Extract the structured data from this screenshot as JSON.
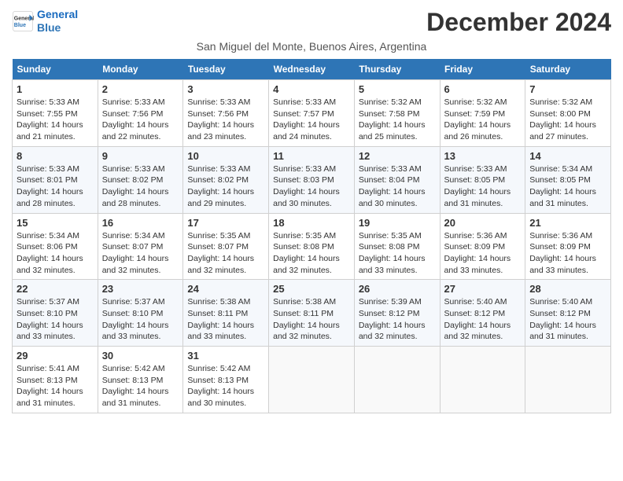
{
  "logo": {
    "line1": "General",
    "line2": "Blue"
  },
  "title": "December 2024",
  "subtitle": "San Miguel del Monte, Buenos Aires, Argentina",
  "weekdays": [
    "Sunday",
    "Monday",
    "Tuesday",
    "Wednesday",
    "Thursday",
    "Friday",
    "Saturday"
  ],
  "weeks": [
    [
      {
        "day": "1",
        "info": "Sunrise: 5:33 AM\nSunset: 7:55 PM\nDaylight: 14 hours\nand 21 minutes."
      },
      {
        "day": "2",
        "info": "Sunrise: 5:33 AM\nSunset: 7:56 PM\nDaylight: 14 hours\nand 22 minutes."
      },
      {
        "day": "3",
        "info": "Sunrise: 5:33 AM\nSunset: 7:56 PM\nDaylight: 14 hours\nand 23 minutes."
      },
      {
        "day": "4",
        "info": "Sunrise: 5:33 AM\nSunset: 7:57 PM\nDaylight: 14 hours\nand 24 minutes."
      },
      {
        "day": "5",
        "info": "Sunrise: 5:32 AM\nSunset: 7:58 PM\nDaylight: 14 hours\nand 25 minutes."
      },
      {
        "day": "6",
        "info": "Sunrise: 5:32 AM\nSunset: 7:59 PM\nDaylight: 14 hours\nand 26 minutes."
      },
      {
        "day": "7",
        "info": "Sunrise: 5:32 AM\nSunset: 8:00 PM\nDaylight: 14 hours\nand 27 minutes."
      }
    ],
    [
      {
        "day": "8",
        "info": "Sunrise: 5:33 AM\nSunset: 8:01 PM\nDaylight: 14 hours\nand 28 minutes."
      },
      {
        "day": "9",
        "info": "Sunrise: 5:33 AM\nSunset: 8:02 PM\nDaylight: 14 hours\nand 28 minutes."
      },
      {
        "day": "10",
        "info": "Sunrise: 5:33 AM\nSunset: 8:02 PM\nDaylight: 14 hours\nand 29 minutes."
      },
      {
        "day": "11",
        "info": "Sunrise: 5:33 AM\nSunset: 8:03 PM\nDaylight: 14 hours\nand 30 minutes."
      },
      {
        "day": "12",
        "info": "Sunrise: 5:33 AM\nSunset: 8:04 PM\nDaylight: 14 hours\nand 30 minutes."
      },
      {
        "day": "13",
        "info": "Sunrise: 5:33 AM\nSunset: 8:05 PM\nDaylight: 14 hours\nand 31 minutes."
      },
      {
        "day": "14",
        "info": "Sunrise: 5:34 AM\nSunset: 8:05 PM\nDaylight: 14 hours\nand 31 minutes."
      }
    ],
    [
      {
        "day": "15",
        "info": "Sunrise: 5:34 AM\nSunset: 8:06 PM\nDaylight: 14 hours\nand 32 minutes."
      },
      {
        "day": "16",
        "info": "Sunrise: 5:34 AM\nSunset: 8:07 PM\nDaylight: 14 hours\nand 32 minutes."
      },
      {
        "day": "17",
        "info": "Sunrise: 5:35 AM\nSunset: 8:07 PM\nDaylight: 14 hours\nand 32 minutes."
      },
      {
        "day": "18",
        "info": "Sunrise: 5:35 AM\nSunset: 8:08 PM\nDaylight: 14 hours\nand 32 minutes."
      },
      {
        "day": "19",
        "info": "Sunrise: 5:35 AM\nSunset: 8:08 PM\nDaylight: 14 hours\nand 33 minutes."
      },
      {
        "day": "20",
        "info": "Sunrise: 5:36 AM\nSunset: 8:09 PM\nDaylight: 14 hours\nand 33 minutes."
      },
      {
        "day": "21",
        "info": "Sunrise: 5:36 AM\nSunset: 8:09 PM\nDaylight: 14 hours\nand 33 minutes."
      }
    ],
    [
      {
        "day": "22",
        "info": "Sunrise: 5:37 AM\nSunset: 8:10 PM\nDaylight: 14 hours\nand 33 minutes."
      },
      {
        "day": "23",
        "info": "Sunrise: 5:37 AM\nSunset: 8:10 PM\nDaylight: 14 hours\nand 33 minutes."
      },
      {
        "day": "24",
        "info": "Sunrise: 5:38 AM\nSunset: 8:11 PM\nDaylight: 14 hours\nand 33 minutes."
      },
      {
        "day": "25",
        "info": "Sunrise: 5:38 AM\nSunset: 8:11 PM\nDaylight: 14 hours\nand 32 minutes."
      },
      {
        "day": "26",
        "info": "Sunrise: 5:39 AM\nSunset: 8:12 PM\nDaylight: 14 hours\nand 32 minutes."
      },
      {
        "day": "27",
        "info": "Sunrise: 5:40 AM\nSunset: 8:12 PM\nDaylight: 14 hours\nand 32 minutes."
      },
      {
        "day": "28",
        "info": "Sunrise: 5:40 AM\nSunset: 8:12 PM\nDaylight: 14 hours\nand 31 minutes."
      }
    ],
    [
      {
        "day": "29",
        "info": "Sunrise: 5:41 AM\nSunset: 8:13 PM\nDaylight: 14 hours\nand 31 minutes."
      },
      {
        "day": "30",
        "info": "Sunrise: 5:42 AM\nSunset: 8:13 PM\nDaylight: 14 hours\nand 31 minutes."
      },
      {
        "day": "31",
        "info": "Sunrise: 5:42 AM\nSunset: 8:13 PM\nDaylight: 14 hours\nand 30 minutes."
      },
      null,
      null,
      null,
      null
    ]
  ]
}
